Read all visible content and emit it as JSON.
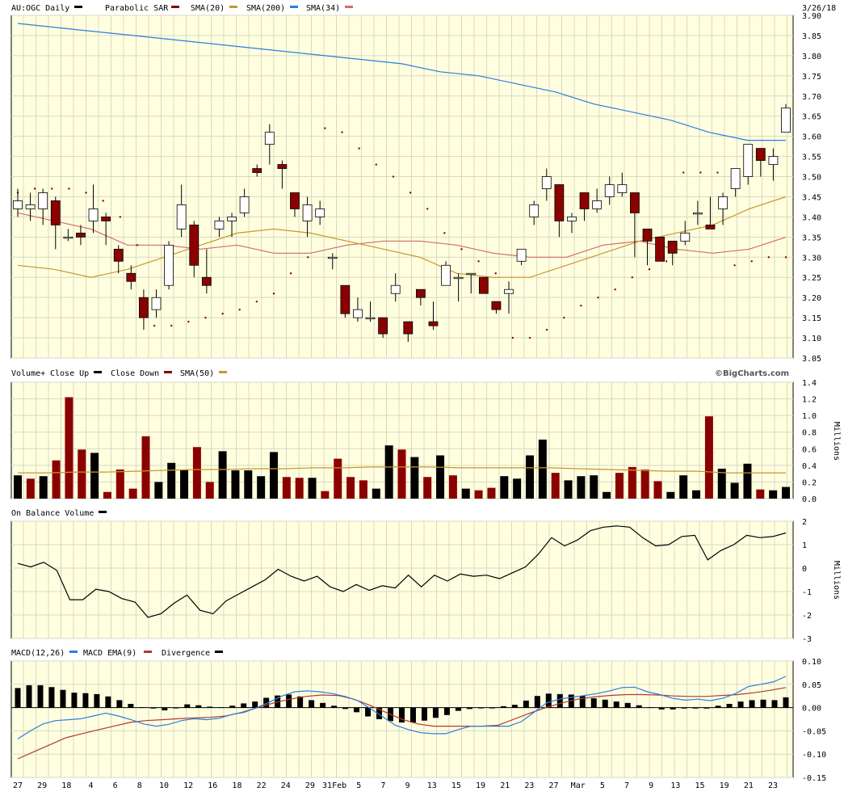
{
  "header": {
    "symbol": "AU:OGC Daily",
    "date": "3/26/18",
    "legend": [
      {
        "label": "Parabolic SAR",
        "color": "#8b0000"
      },
      {
        "label": "SMA(20)",
        "color": "#c8962a"
      },
      {
        "label": "SMA(200)",
        "color": "#2a7de1"
      },
      {
        "label": "SMA(34)",
        "color": "#d46a6a"
      }
    ]
  },
  "colors": {
    "panel_bg": "#ffffe0",
    "grid": "#d8d8c0",
    "up": "#ffffff",
    "down": "#8b0000",
    "black": "#000000",
    "sma20": "#c8962a",
    "sma200": "#2a7de1",
    "sma34": "#d46a6a",
    "macd": "#2a7de1",
    "macd_ema": "#b03a2e"
  },
  "x_labels": [
    "27",
    "29",
    "18",
    "4",
    "6",
    "8",
    "10",
    "12",
    "16",
    "18",
    "22",
    "24",
    "29",
    "31Feb",
    "5",
    "7",
    "9",
    "13",
    "15",
    "19",
    "21",
    "23",
    "27",
    "Mar",
    "5",
    "7",
    "9",
    "13",
    "15",
    "19",
    "21",
    "23"
  ],
  "chart_data": [
    {
      "type": "candlestick",
      "title": "AU:OGC Daily",
      "ylim": [
        3.05,
        3.9
      ],
      "yticks": [
        "3.05",
        "3.10",
        "3.15",
        "3.20",
        "3.25",
        "3.30",
        "3.35",
        "3.40",
        "3.45",
        "3.50",
        "3.55",
        "3.60",
        "3.65",
        "3.70",
        "3.75",
        "3.80",
        "3.85",
        "3.90"
      ],
      "candles": [
        {
          "o": 3.42,
          "h": 3.47,
          "l": 3.4,
          "c": 3.44
        },
        {
          "o": 3.42,
          "h": 3.46,
          "l": 3.39,
          "c": 3.43
        },
        {
          "o": 3.42,
          "h": 3.47,
          "l": 3.38,
          "c": 3.46
        },
        {
          "o": 3.44,
          "h": 3.45,
          "l": 3.32,
          "c": 3.38
        },
        {
          "o": 3.35,
          "h": 3.37,
          "l": 3.34,
          "c": 3.35
        },
        {
          "o": 3.36,
          "h": 3.38,
          "l": 3.33,
          "c": 3.35
        },
        {
          "o": 3.39,
          "h": 3.48,
          "l": 3.36,
          "c": 3.42
        },
        {
          "o": 3.4,
          "h": 3.41,
          "l": 3.33,
          "c": 3.39
        },
        {
          "o": 3.32,
          "h": 3.33,
          "l": 3.26,
          "c": 3.29
        },
        {
          "o": 3.26,
          "h": 3.28,
          "l": 3.22,
          "c": 3.24
        },
        {
          "o": 3.2,
          "h": 3.22,
          "l": 3.12,
          "c": 3.15
        },
        {
          "o": 3.17,
          "h": 3.22,
          "l": 3.15,
          "c": 3.2
        },
        {
          "o": 3.23,
          "h": 3.34,
          "l": 3.22,
          "c": 3.33
        },
        {
          "o": 3.37,
          "h": 3.48,
          "l": 3.35,
          "c": 3.43
        },
        {
          "o": 3.38,
          "h": 3.39,
          "l": 3.25,
          "c": 3.28
        },
        {
          "o": 3.25,
          "h": 3.32,
          "l": 3.21,
          "c": 3.23
        },
        {
          "o": 3.37,
          "h": 3.4,
          "l": 3.35,
          "c": 3.39
        },
        {
          "o": 3.39,
          "h": 3.41,
          "l": 3.35,
          "c": 3.4
        },
        {
          "o": 3.41,
          "h": 3.47,
          "l": 3.4,
          "c": 3.45
        },
        {
          "o": 3.52,
          "h": 3.53,
          "l": 3.5,
          "c": 3.51
        },
        {
          "o": 3.58,
          "h": 3.63,
          "l": 3.53,
          "c": 3.61
        },
        {
          "o": 3.53,
          "h": 3.54,
          "l": 3.47,
          "c": 3.52
        },
        {
          "o": 3.46,
          "h": 3.46,
          "l": 3.4,
          "c": 3.42
        },
        {
          "o": 3.39,
          "h": 3.45,
          "l": 3.35,
          "c": 3.43
        },
        {
          "o": 3.4,
          "h": 3.44,
          "l": 3.38,
          "c": 3.42
        },
        {
          "o": 3.3,
          "h": 3.31,
          "l": 3.27,
          "c": 3.3
        },
        {
          "o": 3.23,
          "h": 3.23,
          "l": 3.15,
          "c": 3.16
        },
        {
          "o": 3.15,
          "h": 3.2,
          "l": 3.14,
          "c": 3.17
        },
        {
          "o": 3.15,
          "h": 3.19,
          "l": 3.14,
          "c": 3.15
        },
        {
          "o": 3.15,
          "h": 3.15,
          "l": 3.1,
          "c": 3.11
        },
        {
          "o": 3.21,
          "h": 3.26,
          "l": 3.19,
          "c": 3.23
        },
        {
          "o": 3.14,
          "h": 3.14,
          "l": 3.09,
          "c": 3.11
        },
        {
          "o": 3.22,
          "h": 3.22,
          "l": 3.18,
          "c": 3.2
        },
        {
          "o": 3.14,
          "h": 3.19,
          "l": 3.12,
          "c": 3.13
        },
        {
          "o": 3.23,
          "h": 3.29,
          "l": 3.23,
          "c": 3.28
        },
        {
          "o": 3.25,
          "h": 3.26,
          "l": 3.19,
          "c": 3.25
        },
        {
          "o": 3.26,
          "h": 3.26,
          "l": 3.21,
          "c": 3.26
        },
        {
          "o": 3.25,
          "h": 3.25,
          "l": 3.21,
          "c": 3.21
        },
        {
          "o": 3.19,
          "h": 3.19,
          "l": 3.16,
          "c": 3.17
        },
        {
          "o": 3.21,
          "h": 3.24,
          "l": 3.16,
          "c": 3.22
        },
        {
          "o": 3.29,
          "h": 3.32,
          "l": 3.28,
          "c": 3.32
        },
        {
          "o": 3.4,
          "h": 3.44,
          "l": 3.38,
          "c": 3.43
        },
        {
          "o": 3.47,
          "h": 3.52,
          "l": 3.44,
          "c": 3.5
        },
        {
          "o": 3.48,
          "h": 3.48,
          "l": 3.35,
          "c": 3.39
        },
        {
          "o": 3.39,
          "h": 3.41,
          "l": 3.36,
          "c": 3.4
        },
        {
          "o": 3.46,
          "h": 3.46,
          "l": 3.39,
          "c": 3.42
        },
        {
          "o": 3.42,
          "h": 3.47,
          "l": 3.41,
          "c": 3.44
        },
        {
          "o": 3.45,
          "h": 3.5,
          "l": 3.43,
          "c": 3.48
        },
        {
          "o": 3.46,
          "h": 3.51,
          "l": 3.45,
          "c": 3.48
        },
        {
          "o": 3.46,
          "h": 3.46,
          "l": 3.3,
          "c": 3.41
        },
        {
          "o": 3.37,
          "h": 3.37,
          "l": 3.28,
          "c": 3.34
        },
        {
          "o": 3.35,
          "h": 3.35,
          "l": 3.29,
          "c": 3.29
        },
        {
          "o": 3.34,
          "h": 3.34,
          "l": 3.28,
          "c": 3.31
        },
        {
          "o": 3.34,
          "h": 3.39,
          "l": 3.33,
          "c": 3.36
        },
        {
          "o": 3.41,
          "h": 3.44,
          "l": 3.38,
          "c": 3.41
        },
        {
          "o": 3.38,
          "h": 3.45,
          "l": 3.37,
          "c": 3.37
        },
        {
          "o": 3.42,
          "h": 3.46,
          "l": 3.38,
          "c": 3.45
        },
        {
          "o": 3.47,
          "h": 3.52,
          "l": 3.45,
          "c": 3.52
        },
        {
          "o": 3.5,
          "h": 3.58,
          "l": 3.48,
          "c": 3.58
        },
        {
          "o": 3.57,
          "h": 3.57,
          "l": 3.5,
          "c": 3.54
        },
        {
          "o": 3.53,
          "h": 3.57,
          "l": 3.49,
          "c": 3.55
        },
        {
          "o": 3.61,
          "h": 3.68,
          "l": 3.61,
          "c": 3.67
        }
      ],
      "sma200": [
        3.88,
        3.87,
        3.86,
        3.85,
        3.84,
        3.83,
        3.82,
        3.81,
        3.8,
        3.79,
        3.78,
        3.76,
        3.75,
        3.73,
        3.71,
        3.68,
        3.66,
        3.64,
        3.61,
        3.59,
        3.59
      ],
      "sma20": [
        3.28,
        3.27,
        3.25,
        3.27,
        3.3,
        3.33,
        3.36,
        3.37,
        3.36,
        3.34,
        3.32,
        3.3,
        3.26,
        3.25,
        3.25,
        3.28,
        3.31,
        3.34,
        3.36,
        3.38,
        3.42,
        3.45
      ],
      "sma34": [
        3.41,
        3.39,
        3.37,
        3.33,
        3.33,
        3.32,
        3.33,
        3.31,
        3.31,
        3.33,
        3.34,
        3.34,
        3.33,
        3.31,
        3.3,
        3.3,
        3.33,
        3.34,
        3.32,
        3.31,
        3.32,
        3.35
      ],
      "sar": [
        3.46,
        3.47,
        3.47,
        3.47,
        3.46,
        3.44,
        3.4,
        3.33,
        3.13,
        3.13,
        3.14,
        3.15,
        3.16,
        3.17,
        3.19,
        3.21,
        3.26,
        3.3,
        3.62,
        3.61,
        3.57,
        3.53,
        3.5,
        3.46,
        3.42,
        3.36,
        3.32,
        3.29,
        3.26,
        3.1,
        3.1,
        3.12,
        3.15,
        3.18,
        3.2,
        3.22,
        3.25,
        3.27,
        3.29,
        3.51,
        3.51,
        3.51,
        3.28,
        3.29,
        3.3,
        3.3
      ]
    },
    {
      "type": "bar",
      "title": "Volume+",
      "legend": [
        {
          "label": "Close Up",
          "color": "#000000"
        },
        {
          "label": "Close Down",
          "color": "#8b0000"
        },
        {
          "label": "SMA(50)",
          "color": "#c8962a"
        }
      ],
      "ylabel": "Millions",
      "ylim": [
        0,
        1.4
      ],
      "yticks": [
        "0.0",
        "0.2",
        "0.4",
        "0.6",
        "0.8",
        "1.0",
        "1.2",
        "1.4"
      ],
      "values": [
        0.28,
        0.24,
        0.27,
        0.46,
        1.22,
        0.59,
        0.55,
        0.08,
        0.35,
        0.12,
        0.75,
        0.2,
        0.43,
        0.35,
        0.62,
        0.2,
        0.57,
        0.34,
        0.34,
        0.27,
        0.56,
        0.26,
        0.25,
        0.25,
        0.09,
        0.48,
        0.26,
        0.22,
        0.12,
        0.64,
        0.59,
        0.5,
        0.26,
        0.52,
        0.28,
        0.12,
        0.1,
        0.13,
        0.27,
        0.24,
        0.52,
        0.71,
        0.31,
        0.22,
        0.27,
        0.28,
        0.08,
        0.31,
        0.38,
        0.35,
        0.21,
        0.08,
        0.28,
        0.1,
        0.99,
        0.36,
        0.19,
        0.42,
        0.11,
        0.1,
        0.14
      ],
      "down": [
        false,
        true,
        false,
        true,
        true,
        true,
        false,
        true,
        true,
        true,
        true,
        false,
        false,
        false,
        true,
        true,
        false,
        false,
        false,
        false,
        false,
        true,
        true,
        false,
        true,
        true,
        true,
        true,
        false,
        false,
        true,
        false,
        true,
        false,
        true,
        false,
        true,
        true,
        false,
        false,
        false,
        false,
        true,
        false,
        false,
        false,
        false,
        true,
        true,
        true,
        true,
        false,
        false,
        false,
        true,
        false,
        false,
        false,
        true,
        false,
        false
      ],
      "sma50": [
        0.31,
        0.31,
        0.32,
        0.32,
        0.33,
        0.34,
        0.35,
        0.35,
        0.36,
        0.36,
        0.37,
        0.37,
        0.38,
        0.38,
        0.38,
        0.37,
        0.37,
        0.37,
        0.37,
        0.36,
        0.35,
        0.34,
        0.33,
        0.33,
        0.31,
        0.31,
        0.31
      ]
    },
    {
      "type": "line",
      "title": "On Balance Volume",
      "ylabel": "Millions",
      "ylim": [
        -3,
        2
      ],
      "yticks": [
        "2",
        "1",
        "0",
        "-1",
        "-2",
        "-3"
      ],
      "values": [
        0.2,
        0.05,
        0.25,
        -0.1,
        -1.35,
        -1.35,
        -0.9,
        -1.0,
        -1.3,
        -1.45,
        -2.1,
        -1.95,
        -1.5,
        -1.15,
        -1.8,
        -1.95,
        -1.4,
        -1.1,
        -0.8,
        -0.5,
        -0.05,
        -0.35,
        -0.55,
        -0.35,
        -0.8,
        -1.0,
        -0.7,
        -0.95,
        -0.75,
        -0.85,
        -0.3,
        -0.8,
        -0.3,
        -0.55,
        -0.25,
        -0.35,
        -0.3,
        -0.45,
        -0.2,
        0.05,
        0.6,
        1.3,
        0.95,
        1.2,
        1.6,
        1.75,
        1.8,
        1.75,
        1.3,
        0.95,
        1.0,
        1.35,
        1.4,
        0.35,
        0.75,
        1.0,
        1.4,
        1.3,
        1.35,
        1.5
      ]
    },
    {
      "type": "bar",
      "title": "MACD(12,26)",
      "legend": [
        {
          "label": "MACD EMA(9)",
          "color": "#2a7de1"
        },
        {
          "label": "Divergence",
          "color": "#000000"
        }
      ],
      "ylim": [
        -0.15,
        0.1
      ],
      "yticks": [
        "0.10",
        "0.05",
        "0.00",
        "-0.05",
        "-0.10",
        "-0.15"
      ],
      "divergence": [
        0.042,
        0.048,
        0.048,
        0.044,
        0.038,
        0.032,
        0.031,
        0.029,
        0.024,
        0.016,
        0.008,
        0.001,
        -0.002,
        -0.006,
        0.0,
        0.007,
        0.005,
        0.002,
        0.001,
        0.004,
        0.009,
        0.013,
        0.021,
        0.026,
        0.028,
        0.024,
        0.016,
        0.01,
        0.004,
        -0.003,
        -0.01,
        -0.019,
        -0.025,
        -0.029,
        -0.032,
        -0.032,
        -0.028,
        -0.022,
        -0.016,
        -0.007,
        -0.003,
        0.0,
        0.0,
        0.003,
        0.006,
        0.015,
        0.025,
        0.03,
        0.029,
        0.028,
        0.025,
        0.02,
        0.017,
        0.013,
        0.01,
        0.005,
        0.001,
        -0.004,
        -0.004,
        -0.002,
        -0.002,
        -0.002,
        0.004,
        0.008,
        0.013,
        0.016,
        0.017,
        0.016,
        0.022
      ],
      "macd": [
        -0.067,
        -0.05,
        -0.035,
        -0.028,
        -0.026,
        -0.024,
        -0.018,
        -0.012,
        -0.018,
        -0.026,
        -0.035,
        -0.04,
        -0.036,
        -0.028,
        -0.024,
        -0.026,
        -0.023,
        -0.015,
        -0.01,
        0.0,
        0.012,
        0.025,
        0.034,
        0.036,
        0.034,
        0.03,
        0.024,
        0.015,
        -0.002,
        -0.02,
        -0.038,
        -0.047,
        -0.054,
        -0.056,
        -0.056,
        -0.047,
        -0.04,
        -0.04,
        -0.04,
        -0.04,
        -0.03,
        -0.01,
        0.01,
        0.018,
        0.022,
        0.026,
        0.03,
        0.036,
        0.043,
        0.044,
        0.034,
        0.028,
        0.02,
        0.016,
        0.018,
        0.015,
        0.02,
        0.03,
        0.045,
        0.05,
        0.055,
        0.067
      ],
      "ema": [
        -0.11,
        -0.095,
        -0.08,
        -0.065,
        -0.056,
        -0.048,
        -0.04,
        -0.032,
        -0.028,
        -0.026,
        -0.024,
        -0.022,
        -0.021,
        -0.018,
        -0.01,
        0.0,
        0.01,
        0.018,
        0.024,
        0.027,
        0.026,
        0.018,
        0.005,
        -0.01,
        -0.025,
        -0.035,
        -0.04,
        -0.04,
        -0.04,
        -0.04,
        -0.038,
        -0.025,
        -0.012,
        0.0,
        0.01,
        0.018,
        0.023,
        0.026,
        0.028,
        0.028,
        0.027,
        0.025,
        0.024,
        0.024,
        0.026,
        0.028,
        0.032,
        0.037,
        0.043
      ]
    }
  ],
  "watermark": "©BigCharts.com"
}
